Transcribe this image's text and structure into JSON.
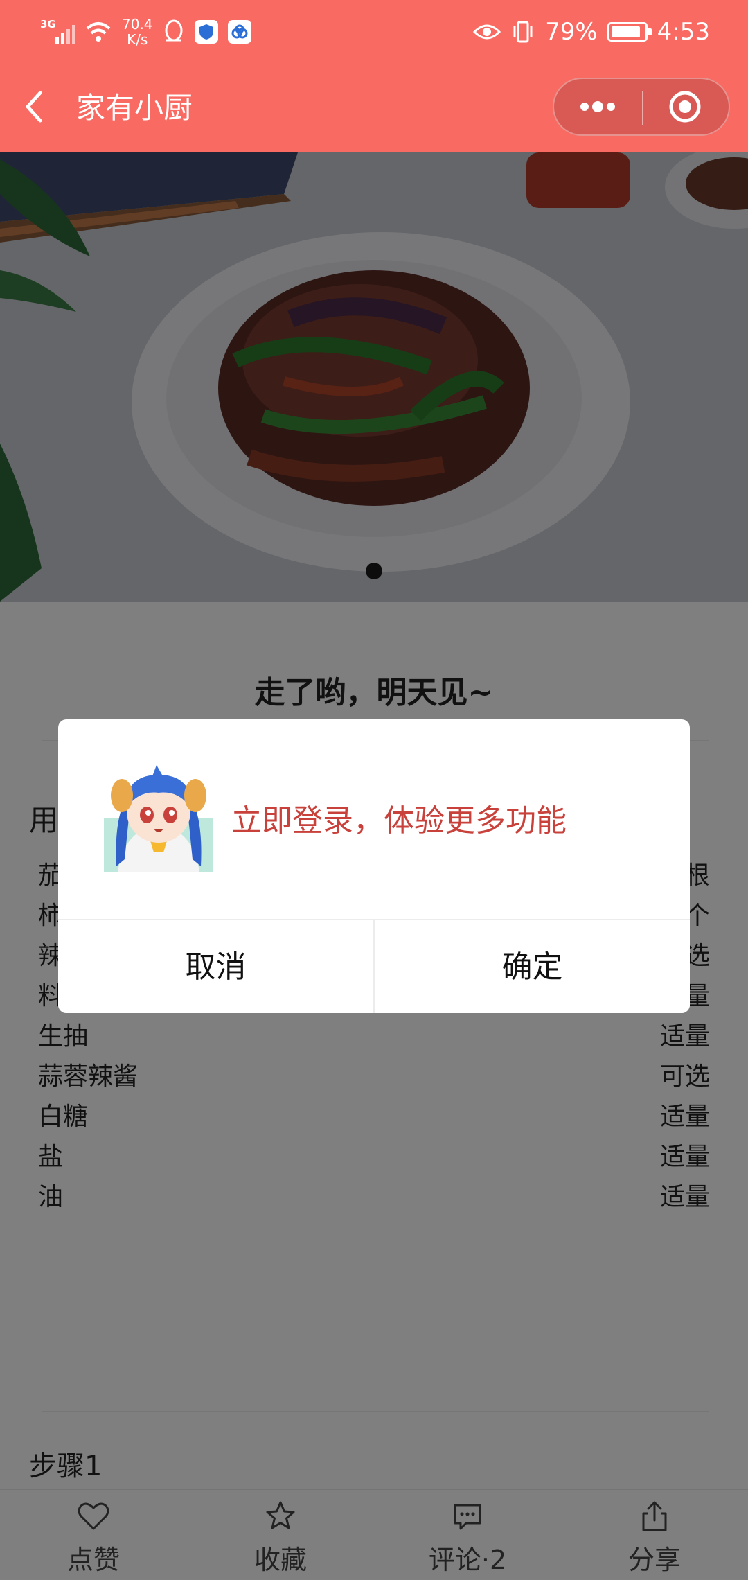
{
  "status_bar": {
    "network": "3G",
    "speed_value": "70.4",
    "speed_unit": "K/s",
    "battery": "79%",
    "time": "4:53"
  },
  "navbar": {
    "title": "家有小厨"
  },
  "hero": {
    "slide_count": 1,
    "active_slide": 1
  },
  "recipe": {
    "title": "走了哟，明天见~",
    "ingredients_heading": "用",
    "ingredients": [
      {
        "name": "茄",
        "amount": "根"
      },
      {
        "name": "柿",
        "amount": "个"
      },
      {
        "name": "辣",
        "amount": "选"
      },
      {
        "name": "料酒",
        "amount": "适量"
      },
      {
        "name": "生抽",
        "amount": "适量"
      },
      {
        "name": "蒜蓉辣酱",
        "amount": "可选"
      },
      {
        "name": "白糖",
        "amount": "适量"
      },
      {
        "name": "盐",
        "amount": "适量"
      },
      {
        "name": "油",
        "amount": "适量"
      }
    ],
    "step_heading": "步骤1"
  },
  "tabbar": {
    "like": "点赞",
    "favorite": "收藏",
    "comment": "评论·2",
    "share": "分享"
  },
  "dialog": {
    "message": "立即登录，体验更多功能",
    "cancel": "取消",
    "confirm": "确定",
    "message_color": "#c8413b"
  },
  "colors": {
    "header": "#f96a63"
  }
}
